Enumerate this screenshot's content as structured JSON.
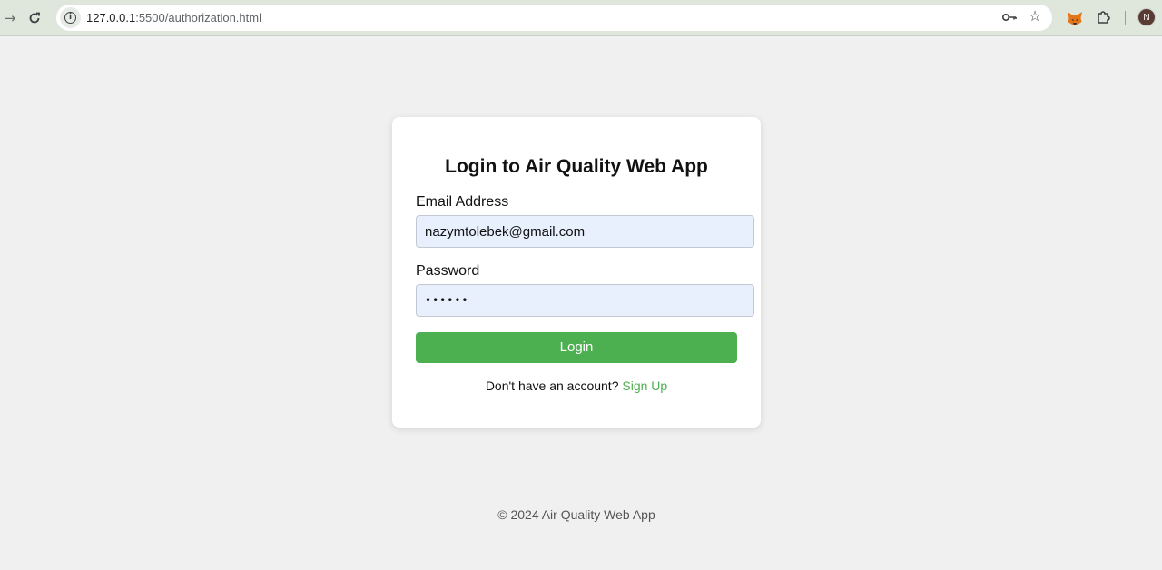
{
  "browser": {
    "url_host": "127.0.0.1",
    "url_rest": ":5500/authorization.html",
    "profile_initial": "N"
  },
  "login": {
    "title": "Login to Air Quality Web App",
    "email_label": "Email Address",
    "email_value": "nazymtolebek@gmail.com",
    "password_label": "Password",
    "password_value": "••••••",
    "button_label": "Login",
    "signup_prompt": "Don't have an account?",
    "signup_link": "Sign Up"
  },
  "footer": {
    "text": "© 2024 Air Quality Web App"
  },
  "colors": {
    "accent": "#4caf50",
    "field_bg": "#e8f0fe",
    "page_bg": "#f0f0f0"
  }
}
